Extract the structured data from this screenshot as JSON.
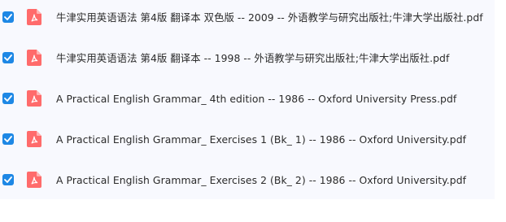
{
  "file_list": {
    "items": [
      {
        "name": "牛津实用英语语法 第4版 翻译本 双色版 -- 2009 -- 外语教学与研究出版社;牛津大学出版社.pdf",
        "checked": true,
        "icon": "pdf-file-icon"
      },
      {
        "name": "牛津实用英语语法 第4版 翻译本 -- 1998 -- 外语教学与研究出版社;牛津大学出版社.pdf",
        "checked": true,
        "icon": "pdf-file-icon"
      },
      {
        "name": "A Practical English Grammar_ 4th edition -- 1986 -- Oxford University Press.pdf",
        "checked": true,
        "icon": "pdf-file-icon"
      },
      {
        "name": "A Practical English Grammar_ Exercises 1 (Bk_ 1) -- 1986 -- Oxford University.pdf",
        "checked": true,
        "icon": "pdf-file-icon"
      },
      {
        "name": "A Practical English Grammar_ Exercises 2 (Bk_ 2) -- 1986 -- Oxford University.pdf",
        "checked": true,
        "icon": "pdf-file-icon"
      }
    ]
  },
  "colors": {
    "checkbox": "#1e88e5",
    "pdf_icon": "#ff6b6b",
    "list_background": "#f8f9fe"
  }
}
